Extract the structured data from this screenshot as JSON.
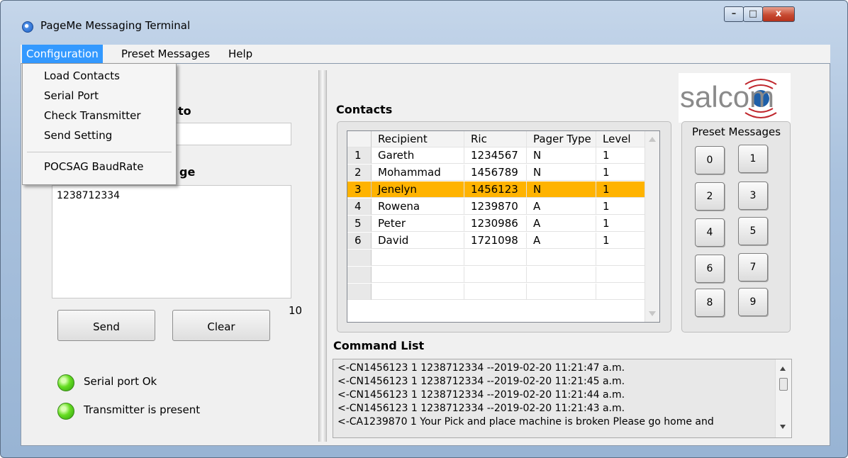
{
  "window": {
    "title": "PageMe  Messaging Terminal",
    "controls": {
      "minimize": "–",
      "maximize": "□",
      "close": "x"
    }
  },
  "menubar": [
    "Configuration",
    "Preset Messages",
    "Help"
  ],
  "config_menu": [
    "Load Contacts",
    "Serial Port",
    "Check Transmitter",
    "Send Setting",
    "POCSAG BaudRate"
  ],
  "left": {
    "send_to_label_partial": "to",
    "message_label_partial": "ge",
    "message_text": "1238712334",
    "char_count": "10",
    "send_button": "Send",
    "clear_button": "Clear",
    "status": [
      "Serial port Ok",
      "Transmitter is present"
    ]
  },
  "contacts": {
    "title": "Contacts",
    "columns": [
      "Recipient",
      "Ric",
      "Pager Type",
      "Level"
    ],
    "rows": [
      {
        "n": "1",
        "recipient": "Gareth",
        "ric": "1234567",
        "type": "N",
        "level": "1"
      },
      {
        "n": "2",
        "recipient": "Mohammad",
        "ric": "1456789",
        "type": "N",
        "level": "1"
      },
      {
        "n": "3",
        "recipient": "Jenelyn",
        "ric": "1456123",
        "type": "N",
        "level": "1"
      },
      {
        "n": "4",
        "recipient": "Rowena",
        "ric": "1239870",
        "type": "A",
        "level": "1"
      },
      {
        "n": "5",
        "recipient": "Peter",
        "ric": "1230986",
        "type": "A",
        "level": "1"
      },
      {
        "n": "6",
        "recipient": "David",
        "ric": "1721098",
        "type": "A",
        "level": "1"
      }
    ],
    "selected_row": "3",
    "selected_color": "#ffb300"
  },
  "preset": {
    "title": "Preset Messages",
    "buttons": [
      "0",
      "1",
      "2",
      "3",
      "4",
      "5",
      "6",
      "7",
      "8",
      "9"
    ]
  },
  "logo": {
    "text": "salcom"
  },
  "command_list": {
    "title": "Command List",
    "lines": [
      "<-CN1456123 1 1238712334  --2019-02-20 11:21:47 a.m.",
      "<-CN1456123 1 1238712334  --2019-02-20 11:21:45 a.m.",
      "<-CN1456123 1 1238712334  --2019-02-20 11:21:44 a.m.",
      "<-CN1456123 1 1238712334  --2019-02-20 11:21:43 a.m.",
      "<-CA1239870 1  Your Pick and place machine is broken Please go home and"
    ]
  }
}
